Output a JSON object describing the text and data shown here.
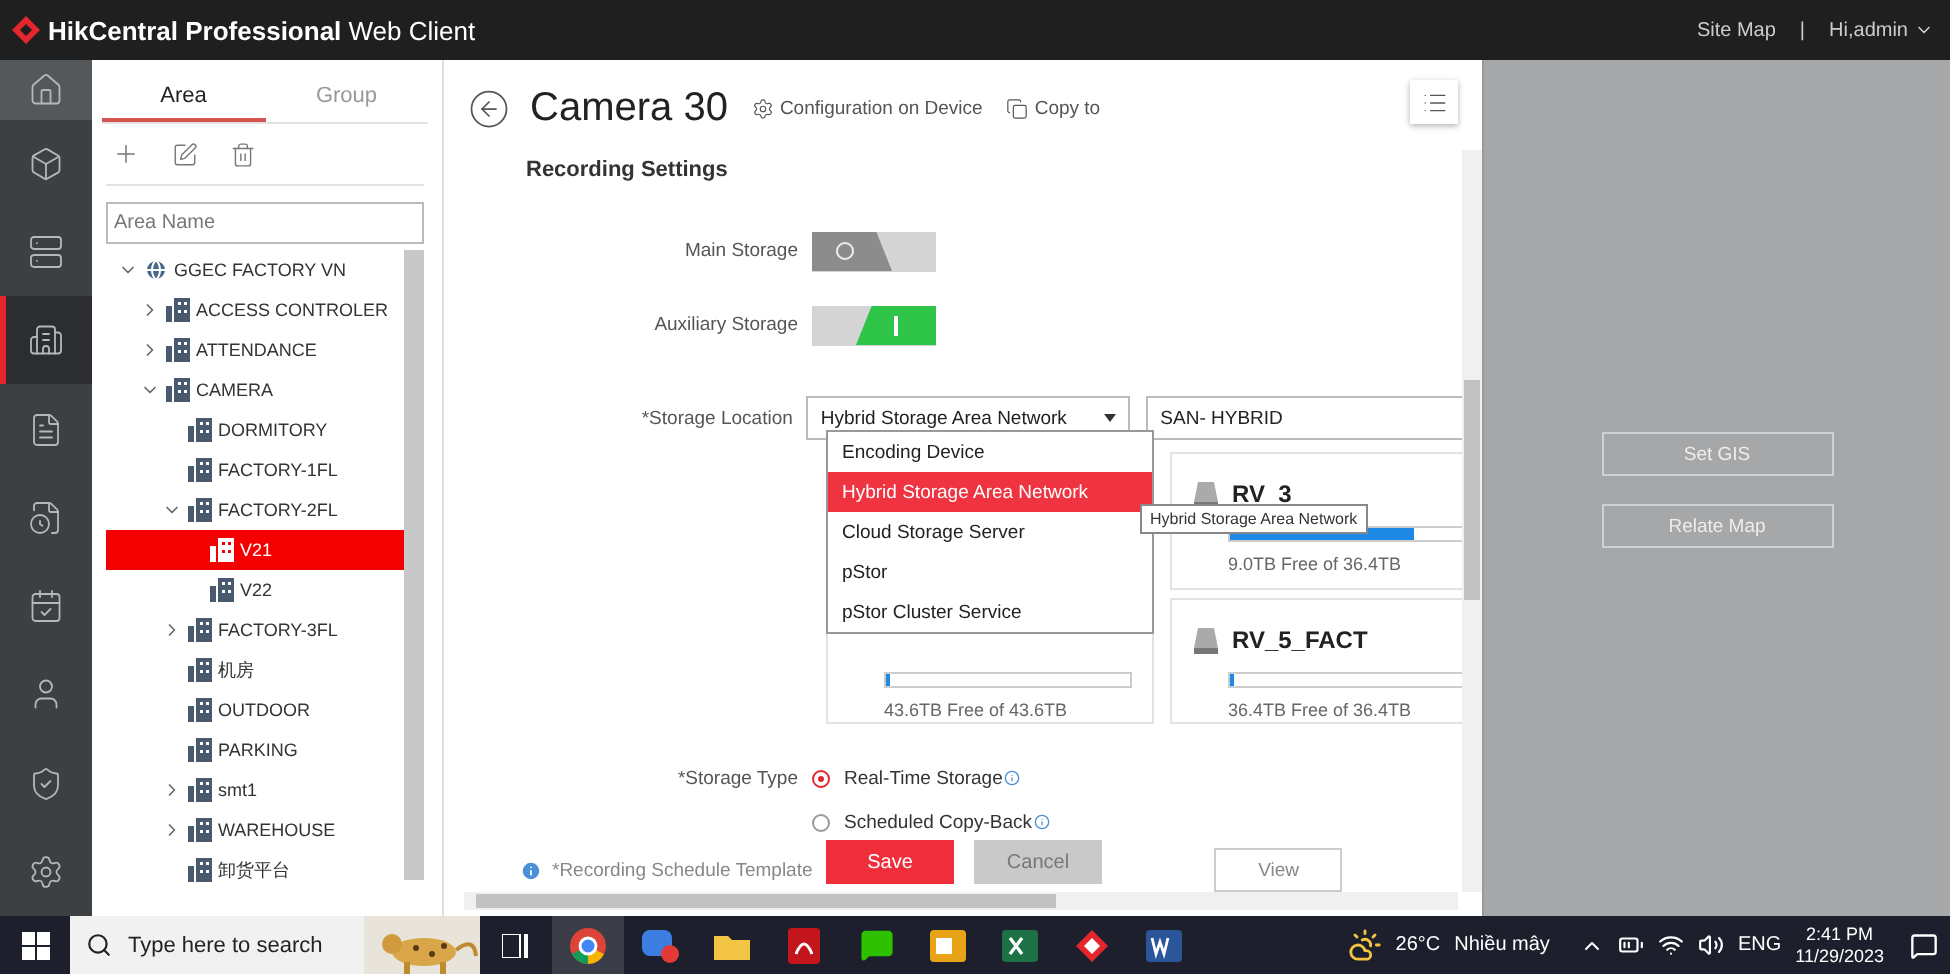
{
  "app": {
    "title": "**HikCentral Professional** Web Client",
    "site_map": "Site Map",
    "separator": "|",
    "user": "Hi,admin"
  },
  "rail": [
    {
      "kind": "home",
      "selected": false
    },
    {
      "kind": "cube",
      "selected": false
    },
    {
      "kind": "server",
      "selected": false
    },
    {
      "kind": "building",
      "selected": true
    },
    {
      "kind": "report",
      "selected": false
    },
    {
      "kind": "schedule",
      "selected": false
    },
    {
      "kind": "calendar",
      "selected": false
    },
    {
      "kind": "person",
      "selected": false
    },
    {
      "kind": "shield",
      "selected": false
    },
    {
      "kind": "settings",
      "selected": false
    }
  ],
  "area_panel": {
    "tabs": [
      {
        "label": "Area",
        "selected": true
      },
      {
        "label": "Group",
        "selected": false
      }
    ],
    "search": {
      "placeholder": "Area Name"
    },
    "tree": [
      {
        "label": "GGEC FACTORY VN",
        "kind": "site",
        "expanded": true,
        "selected": false,
        "children": [
          {
            "label": "ACCESS CONTROLER",
            "kind": "area",
            "expanded": false,
            "selected": false
          },
          {
            "label": "ATTENDANCE",
            "kind": "area",
            "expanded": false,
            "selected": false
          },
          {
            "label": "CAMERA",
            "kind": "area",
            "expanded": true,
            "selected": false,
            "children": [
              {
                "label": "DORMITORY",
                "kind": "area",
                "selected": false
              },
              {
                "label": "FACTORY-1FL",
                "kind": "area",
                "selected": false
              },
              {
                "label": "FACTORY-2FL",
                "kind": "area",
                "expanded": true,
                "selected": false,
                "children": [
                  {
                    "label": "V21",
                    "kind": "area",
                    "selected": true
                  },
                  {
                    "label": "V22",
                    "kind": "area",
                    "selected": false
                  }
                ]
              },
              {
                "label": "FACTORY-3FL",
                "kind": "area",
                "expanded": false,
                "selected": false
              },
              {
                "label": "机房",
                "kind": "area",
                "selected": false
              },
              {
                "label": "OUTDOOR",
                "kind": "area",
                "selected": false
              },
              {
                "label": "PARKING",
                "kind": "area",
                "selected": false
              },
              {
                "label": "smt1",
                "kind": "area",
                "expanded": false,
                "selected": false
              },
              {
                "label": "WAREHOUSE",
                "kind": "area",
                "expanded": false,
                "selected": false
              },
              {
                "label": "卸货平台",
                "kind": "area",
                "selected": false
              }
            ]
          }
        ]
      }
    ]
  },
  "dialog": {
    "title": "Camera 30",
    "actions": [
      {
        "kind": "config",
        "label": "Configuration on Device"
      },
      {
        "kind": "copy",
        "label": "Copy to"
      }
    ],
    "section": "Recording Settings",
    "toggles": [
      {
        "label": "Main Storage",
        "on": false
      },
      {
        "label": "Auxiliary Storage",
        "on": true
      }
    ],
    "storage_location": {
      "label": "*Storage Location",
      "value": "Hybrid Storage Area Network",
      "server": "SAN- HYBRID",
      "expanded": true,
      "options": [
        {
          "label": "Encoding Device",
          "selected": false
        },
        {
          "label": "Hybrid Storage Area Network",
          "selected": true
        },
        {
          "label": "Cloud Storage Server",
          "selected": false
        },
        {
          "label": "pStor",
          "selected": false
        },
        {
          "label": "pStor Cluster Service",
          "selected": false
        }
      ]
    },
    "tooltip": "Hybrid Storage Area Network",
    "storage_cards": [
      {
        "name": "RV_3",
        "level": 0.75,
        "free": "9.0TB Free of 36.4TB"
      },
      {
        "level": 0.01,
        "free": "43.6TB Free of 43.6TB"
      },
      {
        "name": "RV_5_FACT",
        "level": 0.01,
        "free": "36.4TB Free of 36.4TB"
      }
    ],
    "storage_type": {
      "label": "*Storage Type",
      "options": [
        {
          "label": "Real-Time Storage",
          "selected": true
        },
        {
          "label": "Scheduled Copy-Back",
          "selected": false
        }
      ]
    },
    "schedule": {
      "label": "*Recording Schedule Template",
      "view": "View"
    },
    "save": "Save",
    "cancel": "Cancel"
  },
  "map_panel": {
    "buttons": [
      "Set GIS",
      "Relate Map"
    ]
  },
  "taskbar": {
    "search": {
      "placeholder": "Type here to search"
    },
    "weather": {
      "temp": "26°C",
      "desc": "Nhiều mây"
    },
    "language": "ENG",
    "time": "2:41 PM",
    "date": "11/29/2023"
  }
}
